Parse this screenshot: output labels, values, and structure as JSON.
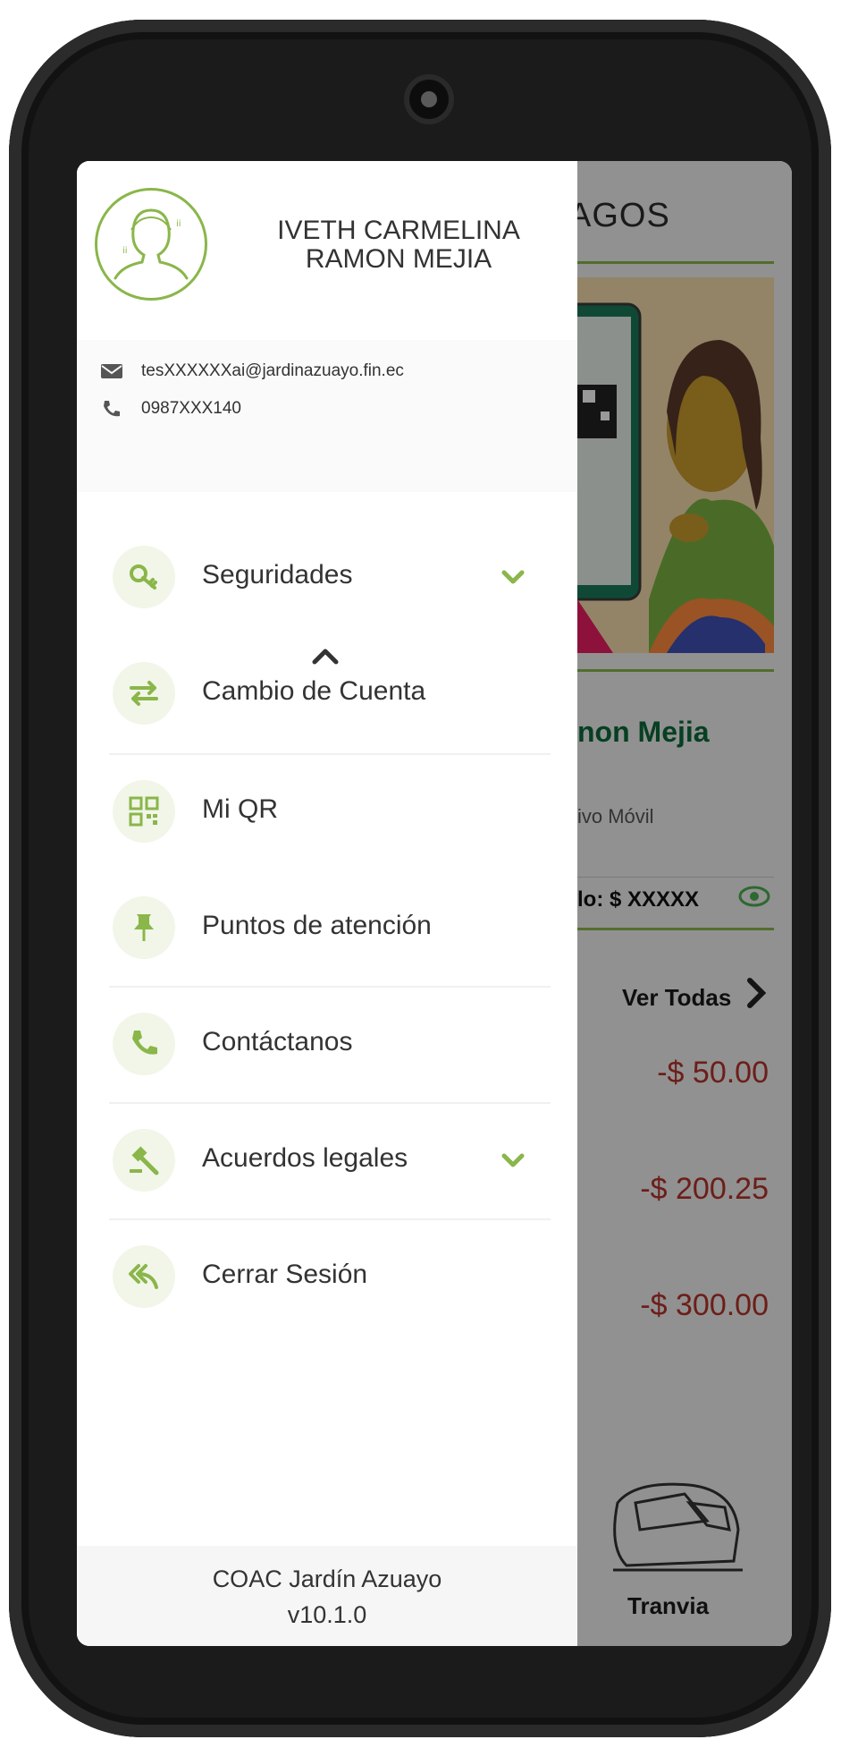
{
  "colors": {
    "accent": "#8ab64a",
    "icon_bg": "#f1f6e8",
    "brand_dark": "#0c6a3a",
    "negative": "#b5322b"
  },
  "drawer": {
    "user_name": "IVETH CARMELINA RAMON MEJIA",
    "email": "tesXXXXXXai@jardinazuayo.fin.ec",
    "phone": "0987XXX140",
    "menu": [
      {
        "label": "Seguridades",
        "icon": "key-icon",
        "expandable": true
      },
      {
        "label": "Cambio de Cuenta",
        "icon": "swap-arrows-icon",
        "expandable": false
      },
      {
        "label": "Mi QR",
        "icon": "qr-code-icon",
        "expandable": false
      },
      {
        "label": "Puntos de atención",
        "icon": "pin-icon",
        "expandable": false
      },
      {
        "label": "Contáctanos",
        "icon": "phone-icon",
        "expandable": false
      },
      {
        "label": "Acuerdos legales",
        "icon": "gavel-icon",
        "expandable": true
      },
      {
        "label": "Cerrar Sesión",
        "icon": "reply-all-icon",
        "expandable": false
      }
    ],
    "footer": {
      "app_name": "COAC Jardín Azuayo",
      "version": "v10.1.0"
    }
  },
  "background": {
    "title_partial": "AGOS",
    "name_partial": "non Mejia",
    "subtitle_partial": "ivo Móvil",
    "balance_label_partial": "lo:  $ XXXXX",
    "see_all": "Ver Todas",
    "amounts": [
      "-$ 50.00",
      "-$ 200.25",
      "-$ 300.00"
    ],
    "shortcut_label": "Tranvia"
  }
}
